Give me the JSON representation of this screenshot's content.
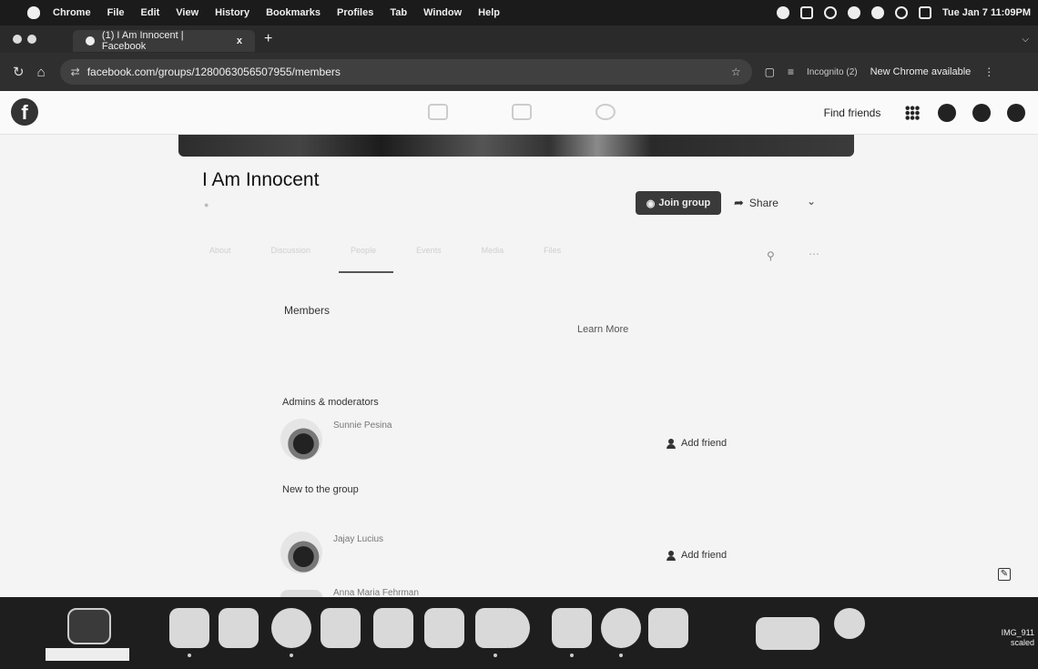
{
  "menubar": {
    "items": [
      "Chrome",
      "File",
      "Edit",
      "View",
      "History",
      "Bookmarks",
      "Profiles",
      "Tab",
      "Window",
      "Help"
    ],
    "clock": "Tue Jan 7  11:09PM"
  },
  "browser": {
    "tab_title": "(1) I Am Innocent | Facebook",
    "tab_close": "x",
    "new_tab": "+",
    "url": "facebook.com/groups/1280063056507955/members",
    "incognito_label": "Incognito (2)",
    "update_label": "New Chrome available"
  },
  "facebook": {
    "logo": "f",
    "find_friends": "Find friends"
  },
  "group": {
    "title": "I Am Innocent",
    "join_label": "Join group",
    "share_label": "Share",
    "tabs": [
      "About",
      "Discussion",
      "People",
      "Events",
      "Media",
      "Files"
    ]
  },
  "members": {
    "heading": "Members",
    "learn_more": "Learn More",
    "admins_heading": "Admins & moderators",
    "admin": {
      "name": "Sunnie Pesina",
      "action": "Add friend"
    },
    "new_heading": "New to the group",
    "new_members": [
      {
        "name": "Jajay Lucius",
        "action": "Add friend"
      },
      {
        "name": "Anna Maria Fehrman"
      }
    ]
  },
  "dock": {
    "file_label": "IMG_911\nscaled"
  }
}
